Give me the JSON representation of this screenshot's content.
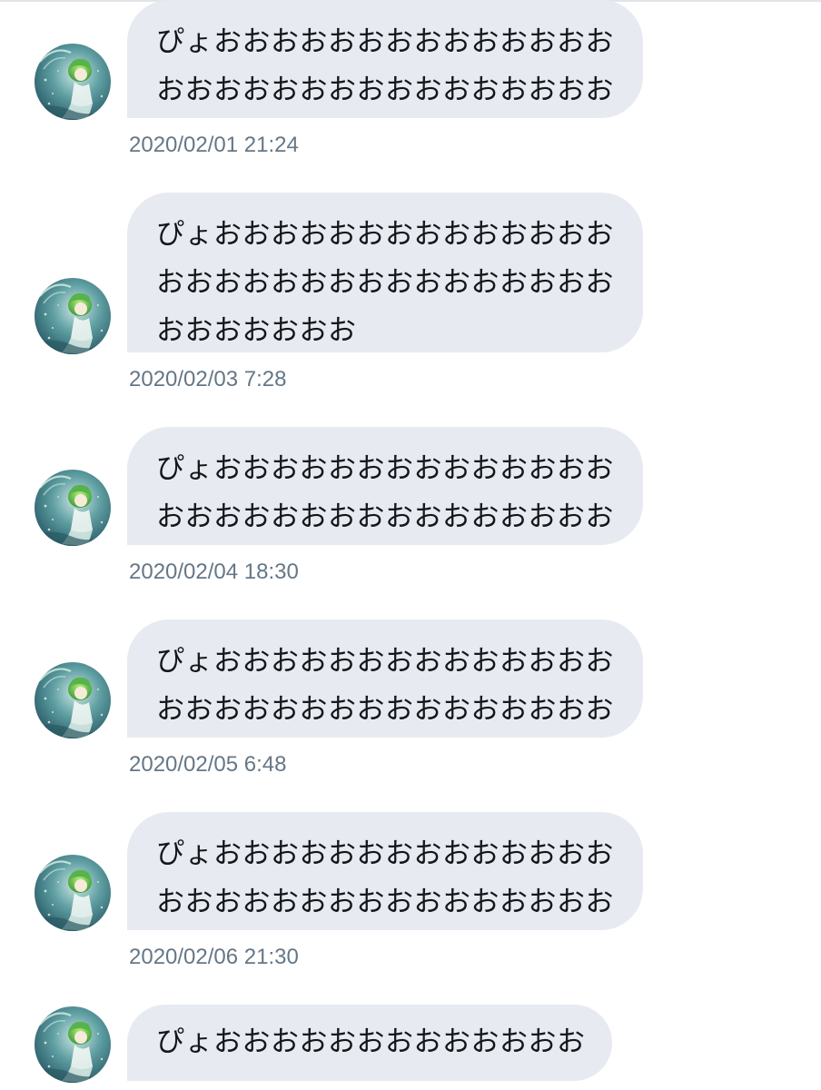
{
  "messages": [
    {
      "lines": [
        "ぴょおおおおおおおおおおおおおお",
        "おおおおおおおおおおおおおおおお"
      ],
      "timestamp": "2020/02/01 21:24"
    },
    {
      "lines": [
        "ぴょおおおおおおおおおおおおおお",
        "おおおおおおおおおおおおおおおお",
        "おおおおおおお"
      ],
      "timestamp": "2020/02/03 7:28"
    },
    {
      "lines": [
        "ぴょおおおおおおおおおおおおおお",
        "おおおおおおおおおおおおおおおお"
      ],
      "timestamp": "2020/02/04 18:30"
    },
    {
      "lines": [
        "ぴょおおおおおおおおおおおおおお",
        "おおおおおおおおおおおおおおおお"
      ],
      "timestamp": "2020/02/05 6:48"
    },
    {
      "lines": [
        "ぴょおおおおおおおおおおおおおお",
        "おおおおおおおおおおおおおおおお"
      ],
      "timestamp": "2020/02/06 21:30"
    },
    {
      "lines": [
        "ぴょおおおおおおおおおおおおお"
      ],
      "timestamp": ""
    }
  ],
  "colors": {
    "bubble_background": "#e7eaf1",
    "message_text": "#14171a",
    "timestamp_text": "#657786"
  }
}
